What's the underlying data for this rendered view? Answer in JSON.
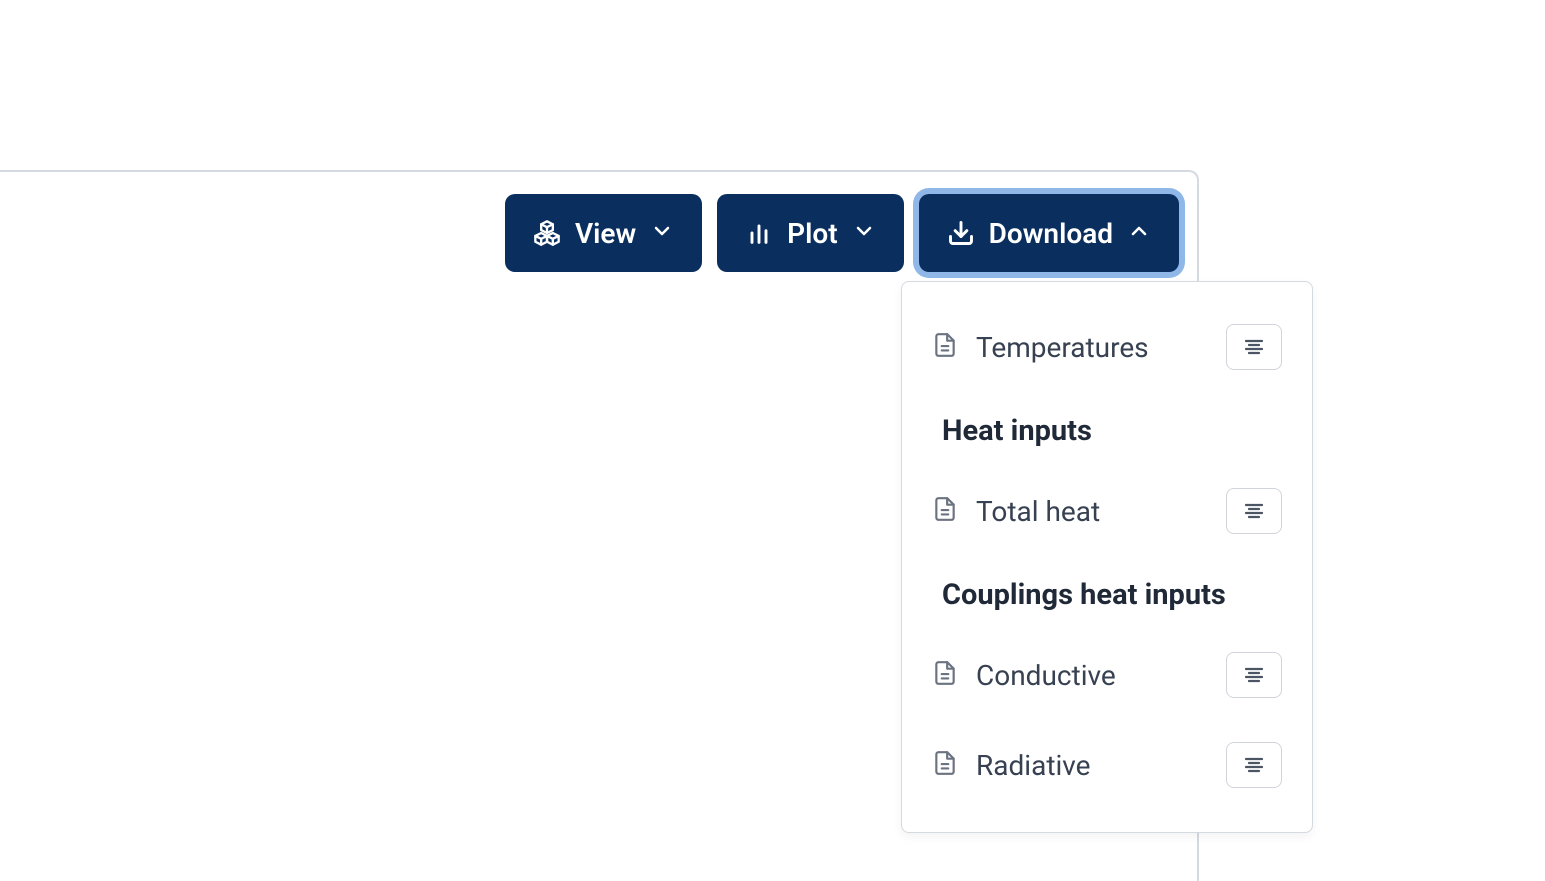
{
  "toolbar": {
    "view_label": "View",
    "plot_label": "Plot",
    "download_label": "Download"
  },
  "dropdown": {
    "group1": {
      "items": [
        {
          "label": "Temperatures"
        }
      ]
    },
    "group2": {
      "title": "Heat inputs",
      "items": [
        {
          "label": "Total heat"
        }
      ]
    },
    "group3": {
      "title": "Couplings heat inputs",
      "items": [
        {
          "label": "Conductive"
        },
        {
          "label": "Radiative"
        }
      ]
    }
  }
}
